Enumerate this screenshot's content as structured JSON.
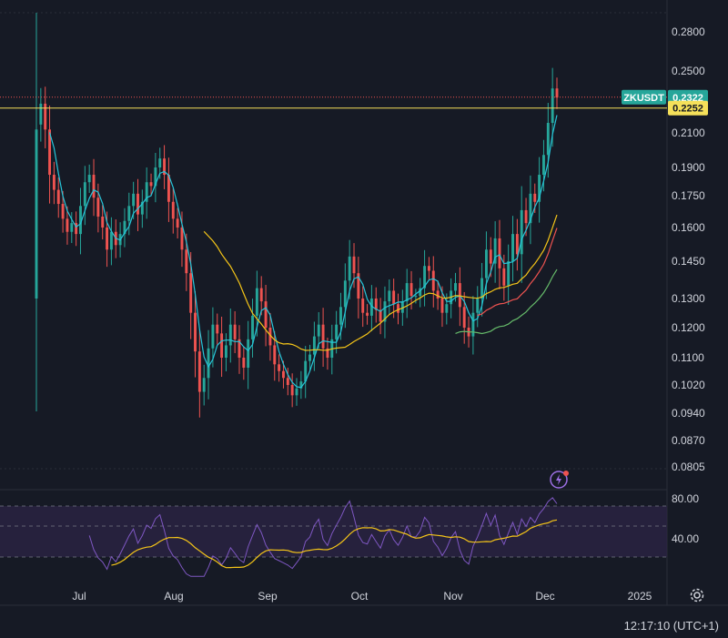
{
  "chart_data": [
    {
      "type": "candlestick",
      "symbol": "ZKUSDT",
      "last_price": "0.2322",
      "ref_price": "0.2252",
      "x_ticks": [
        "Jul",
        "Aug",
        "Sep",
        "Oct",
        "Nov",
        "Dec",
        "2025"
      ],
      "y_ticks": [
        "0.2800",
        "0.2500",
        "0.2100",
        "0.1900",
        "0.1750",
        "0.1600",
        "0.1450",
        "0.1300",
        "0.1200",
        "0.1100",
        "0.1020",
        "0.0940",
        "0.0870",
        "0.0805"
      ],
      "ylim": [
        0.0805,
        0.28
      ],
      "log_scale": true,
      "grid": false,
      "date_range": [
        "2024-06-17",
        "2024-12-05"
      ],
      "candles_close": [
        0.215,
        0.228,
        0.212,
        0.186,
        0.178,
        0.171,
        0.164,
        0.158,
        0.162,
        0.157,
        0.17,
        0.182,
        0.186,
        0.174,
        0.165,
        0.16,
        0.15,
        0.158,
        0.152,
        0.157,
        0.163,
        0.17,
        0.176,
        0.166,
        0.172,
        0.182,
        0.18,
        0.19,
        0.195,
        0.186,
        0.172,
        0.164,
        0.16,
        0.15,
        0.14,
        0.125,
        0.112,
        0.1,
        0.104,
        0.113,
        0.121,
        0.118,
        0.11,
        0.114,
        0.121,
        0.116,
        0.11,
        0.107,
        0.116,
        0.124,
        0.134,
        0.129,
        0.12,
        0.114,
        0.108,
        0.106,
        0.104,
        0.102,
        0.099,
        0.101,
        0.103,
        0.109,
        0.111,
        0.117,
        0.121,
        0.113,
        0.11,
        0.116,
        0.121,
        0.127,
        0.137,
        0.147,
        0.14,
        0.13,
        0.125,
        0.124,
        0.13,
        0.126,
        0.122,
        0.129,
        0.133,
        0.128,
        0.125,
        0.129,
        0.136,
        0.131,
        0.131,
        0.134,
        0.143,
        0.141,
        0.133,
        0.13,
        0.125,
        0.128,
        0.133,
        0.136,
        0.127,
        0.12,
        0.117,
        0.125,
        0.13,
        0.138,
        0.15,
        0.144,
        0.155,
        0.142,
        0.135,
        0.145,
        0.157,
        0.148,
        0.168,
        0.162,
        0.176,
        0.172,
        0.186,
        0.197,
        0.216,
        0.238,
        0.232
      ],
      "series": [
        {
          "name": "MA",
          "kind": "line",
          "color": "#26c6da"
        },
        {
          "name": "MA",
          "kind": "line",
          "color": "#f5c518"
        },
        {
          "name": "MA",
          "kind": "line",
          "color": "#ef5350"
        },
        {
          "name": "MA",
          "kind": "line",
          "color": "#66bb6a"
        }
      ],
      "ma_colors": [
        "#26c6da",
        "#f5c518",
        "#ef5350",
        "#66bb6a"
      ],
      "colors": {
        "up": "#26a69a",
        "down": "#ef5350",
        "ref_line": "#f5e05a",
        "last_line": "#ef5350"
      }
    },
    {
      "type": "line",
      "panel": "RSI",
      "y_ticks": [
        "80.00",
        "40.00"
      ],
      "ylim": [
        20,
        90
      ],
      "series": [
        {
          "kind": "line",
          "color": "#7e57c2"
        },
        {
          "kind": "line",
          "color": "#f5c518"
        }
      ],
      "band": [
        30,
        70
      ]
    }
  ],
  "clock": "12:17:10 (UTC+1)",
  "icons": {
    "settings": "gear-icon",
    "alert": "lightning-icon"
  }
}
